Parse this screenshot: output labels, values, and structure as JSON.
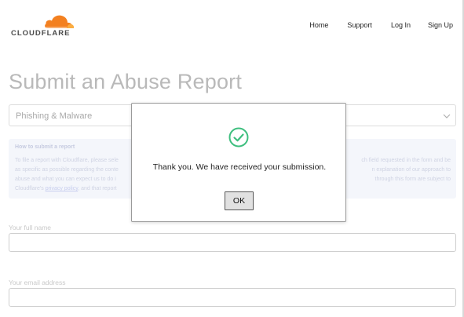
{
  "header": {
    "logo_text": "CLOUDFLARE",
    "nav": {
      "home": "Home",
      "support": "Support",
      "login": "Log In",
      "signup": "Sign Up"
    }
  },
  "main": {
    "title": "Submit an Abuse Report",
    "report_type": {
      "selected": "Phishing & Malware"
    },
    "info": {
      "heading": "How to submit a report",
      "line1a": "To file a report with Cloudflare, please sele",
      "line1b": "ch field requested in the form and be",
      "line2a": "as specific as possible regarding the conte",
      "line2b": "n explanation of our approach to",
      "line3a": "abuse and what you can expect us to do i",
      "line3b": "through this form are subject to",
      "line4a": "Cloudflare's ",
      "link": "privacy policy",
      "line4b": ", and that report"
    },
    "fields": {
      "full_name_label": "Your full name",
      "full_name_value": "",
      "email_label": "Your email address",
      "email_value": ""
    }
  },
  "dialog": {
    "message": "Thank you. We have received your submission.",
    "ok_label": "OK",
    "icon": "check-circle-icon",
    "icon_color": "#3fbf7f"
  },
  "colors": {
    "brand_orange": "#f38020",
    "brand_orange_light": "#fbad41"
  }
}
